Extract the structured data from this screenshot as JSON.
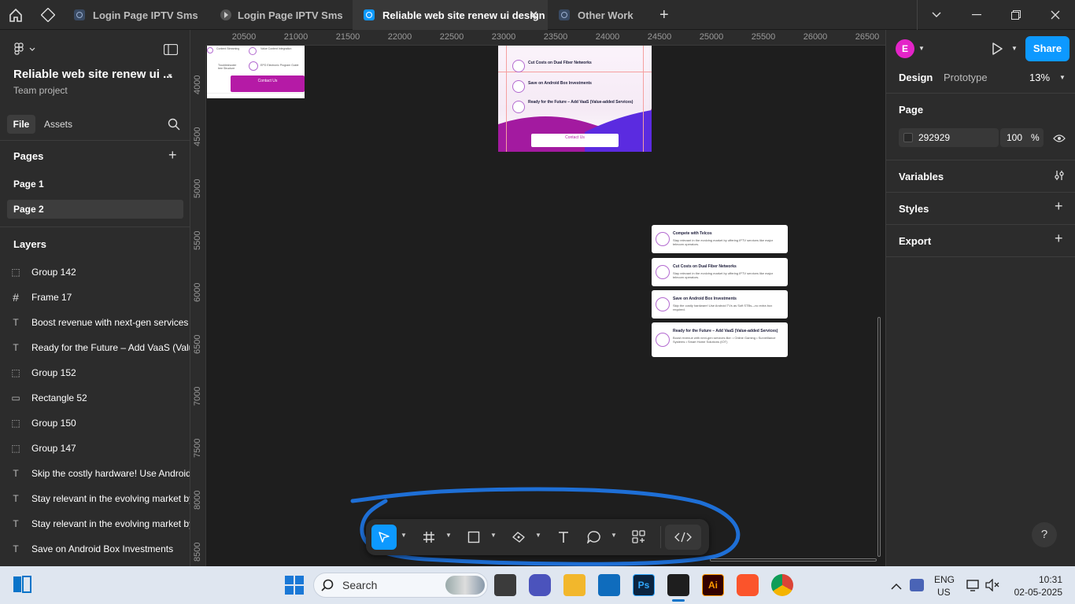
{
  "tabs": [
    {
      "label": "Login Page IPTV Sms",
      "active": false
    },
    {
      "label": "Login Page IPTV Sms",
      "active": false
    },
    {
      "label": "Reliable web site renew ui design",
      "active": true
    },
    {
      "label": "Other Work",
      "active": false
    }
  ],
  "file": {
    "title": "Reliable web site renew ui ...",
    "subtitle": "Team project"
  },
  "left_tabs": {
    "file": "File",
    "assets": "Assets"
  },
  "pages": {
    "header": "Pages",
    "items": [
      "Page 1",
      "Page 2"
    ],
    "selected": "Page 2"
  },
  "layers": {
    "header": "Layers",
    "items": [
      {
        "icon": "group-icon",
        "label": "Group 142"
      },
      {
        "icon": "frame-icon",
        "label": "Frame 17"
      },
      {
        "icon": "text-icon",
        "label": "Boost revenue with next-gen services"
      },
      {
        "icon": "text-icon",
        "label": "Ready for the Future – Add VaaS (Valu"
      },
      {
        "icon": "group-icon",
        "label": "Group 152"
      },
      {
        "icon": "rectangle-icon",
        "label": "Rectangle 52"
      },
      {
        "icon": "group-icon",
        "label": "Group 150"
      },
      {
        "icon": "group-icon",
        "label": "Group 147"
      },
      {
        "icon": "text-icon",
        "label": "Skip the costly hardware! Use Android"
      },
      {
        "icon": "text-icon",
        "label": "Stay relevant in the evolving market by"
      },
      {
        "icon": "text-icon",
        "label": "Stay relevant in the evolving market by"
      },
      {
        "icon": "text-icon",
        "label": "Save on Android Box Investments"
      }
    ]
  },
  "ruler": {
    "h": [
      "20500",
      "21000",
      "21500",
      "22000",
      "22500",
      "23000",
      "23500",
      "24000",
      "24500",
      "25000",
      "25500",
      "26000",
      "26500"
    ],
    "v": [
      "4000",
      "4500",
      "5000",
      "5500",
      "6000",
      "6500",
      "7000",
      "7500",
      "8000",
      "8500"
    ]
  },
  "canvas_cards": [
    {
      "title": "Compete with Telcos",
      "text": "Stay relevant in the evolving market by offering IPTV services like major telecom operators."
    },
    {
      "title": "Cut Costs on Dual  Fiber Networks",
      "text": "Stay relevant in the evolving market by offering IPTV services like major telecom operators."
    },
    {
      "title": "Save on Android Box Investments",
      "text": "Skip the costly hardware! Use Android TVs as Soft STBs—no extra box required."
    },
    {
      "title": "Ready for the Future – Add VaaS (Value-added Services)",
      "text": "Boost revenue with next-gen services like: • Online Gaming • Surveillance Systems • Smart Home Solutions (IOT)"
    }
  ],
  "frame_upper": {
    "items": [
      "Cut Costs on Dual  Fiber Networks",
      "Save on Android Box Investments",
      "Ready for the Future – Add VaaS (Value-added Services)"
    ],
    "contact": "Contact Us"
  },
  "frame_left": {
    "contact": "Contact Us",
    "labels": [
      "Content Streaming",
      "Value Content Integration",
      "Troubleshooter tree Structure",
      "EPG Electronic Program Guide"
    ]
  },
  "right": {
    "avatar": "E",
    "share": "Share",
    "tab_design": "Design",
    "tab_prototype": "Prototype",
    "zoom": "13%",
    "page_label": "Page",
    "bg_hex": "292929",
    "bg_opacity": "100",
    "percent": "%",
    "variables": "Variables",
    "styles": "Styles",
    "export": "Export",
    "help": "?"
  },
  "taskbar": {
    "search": "Search",
    "lang1": "ENG",
    "lang2": "US",
    "time": "10:31",
    "date": "02-05-2025"
  },
  "colors": {
    "accent": "#0d99ff",
    "annotation": "#1e6fd6",
    "magenta": "#b51aa6",
    "purple": "#5b2be0"
  }
}
